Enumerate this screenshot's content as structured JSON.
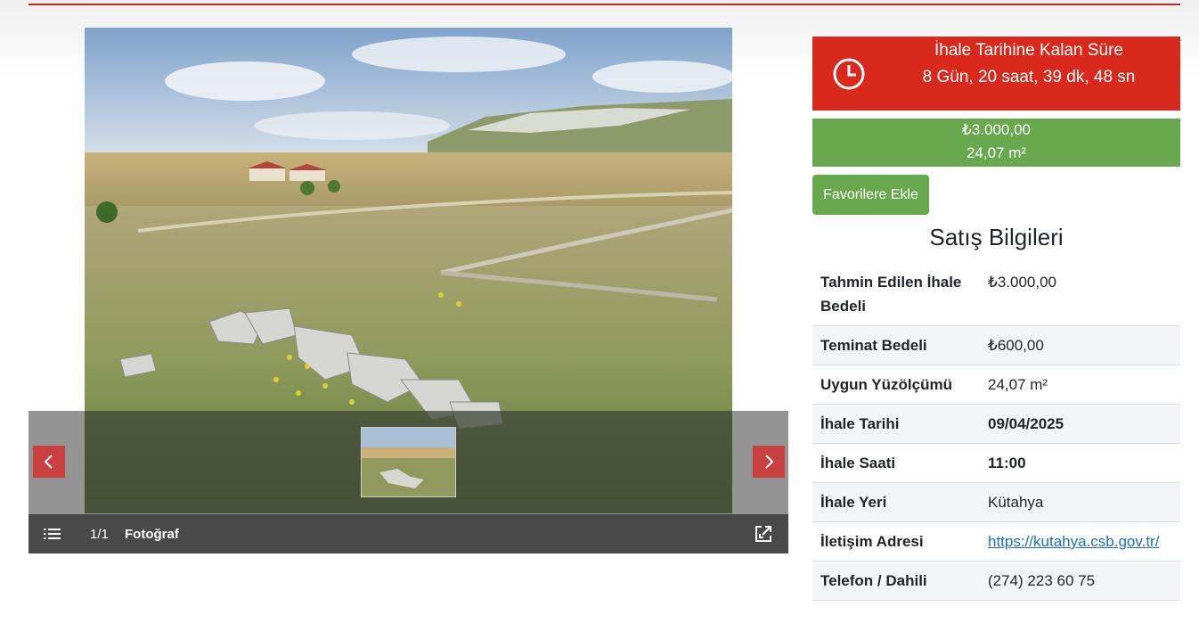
{
  "gallery": {
    "counter": "1/1",
    "caption": "Fotoğraf",
    "icons": {
      "prev": "chevron-left-icon",
      "next": "chevron-right-icon",
      "list": "list-icon",
      "expand": "expand-icon"
    }
  },
  "countdown": {
    "title": "İhale Tarihine Kalan Süre",
    "value": "8 Gün, 20 saat, 39 dk, 48 sn",
    "icon": "clock-icon"
  },
  "price_box": {
    "price": "₺3.000,00",
    "area": "24,07 m²"
  },
  "favorite_button": {
    "label": "Favorilere Ekle"
  },
  "sales_info": {
    "title": "Satış Bilgileri",
    "rows": [
      {
        "label": "Tahmin Edilen İhale Bedeli",
        "value": "₺3.000,00"
      },
      {
        "label": "Teminat Bedeli",
        "value": "₺600,00"
      },
      {
        "label": "Uygun Yüzölçümü",
        "value": "24,07 m²"
      },
      {
        "label": "İhale Tarihi",
        "value": "09/04/2025"
      },
      {
        "label": "İhale Saati",
        "value": "11:00"
      },
      {
        "label": "İhale Yeri",
        "value": "Kütahya"
      },
      {
        "label": "İletişim Adresi",
        "value": "https://kutahya.csb.gov.tr/"
      },
      {
        "label": "Telefon / Dahili",
        "value": "(274) 223 60 75"
      }
    ]
  },
  "colors": {
    "accent_red": "#d9291d",
    "accent_green": "#68a94d",
    "arrow_red": "#c94040",
    "toolbar": "#494949",
    "link": "#1a6fd1"
  }
}
